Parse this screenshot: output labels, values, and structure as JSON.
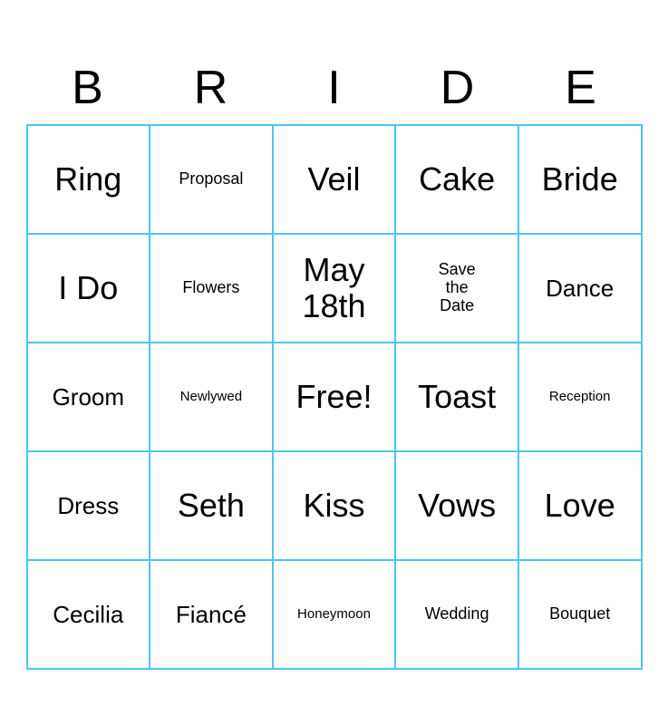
{
  "header": {
    "letters": [
      "B",
      "R",
      "I",
      "D",
      "E"
    ]
  },
  "grid": {
    "rows": [
      [
        {
          "text": "Ring",
          "size": "large"
        },
        {
          "text": "Proposal",
          "size": "small"
        },
        {
          "text": "Veil",
          "size": "large"
        },
        {
          "text": "Cake",
          "size": "large"
        },
        {
          "text": "Bride",
          "size": "large"
        }
      ],
      [
        {
          "text": "I Do",
          "size": "large"
        },
        {
          "text": "Flowers",
          "size": "small"
        },
        {
          "text": "May\n18th",
          "size": "large"
        },
        {
          "text": "Save\nthe\nDate",
          "size": "small"
        },
        {
          "text": "Dance",
          "size": "medium"
        }
      ],
      [
        {
          "text": "Groom",
          "size": "medium"
        },
        {
          "text": "Newlywed",
          "size": "xsmall"
        },
        {
          "text": "Free!",
          "size": "large"
        },
        {
          "text": "Toast",
          "size": "large"
        },
        {
          "text": "Reception",
          "size": "xsmall"
        }
      ],
      [
        {
          "text": "Dress",
          "size": "medium"
        },
        {
          "text": "Seth",
          "size": "large"
        },
        {
          "text": "Kiss",
          "size": "large"
        },
        {
          "text": "Vows",
          "size": "large"
        },
        {
          "text": "Love",
          "size": "large"
        }
      ],
      [
        {
          "text": "Cecilia",
          "size": "medium"
        },
        {
          "text": "Fiancé",
          "size": "medium"
        },
        {
          "text": "Honeymoon",
          "size": "xsmall"
        },
        {
          "text": "Wedding",
          "size": "small"
        },
        {
          "text": "Bouquet",
          "size": "small"
        }
      ]
    ]
  }
}
